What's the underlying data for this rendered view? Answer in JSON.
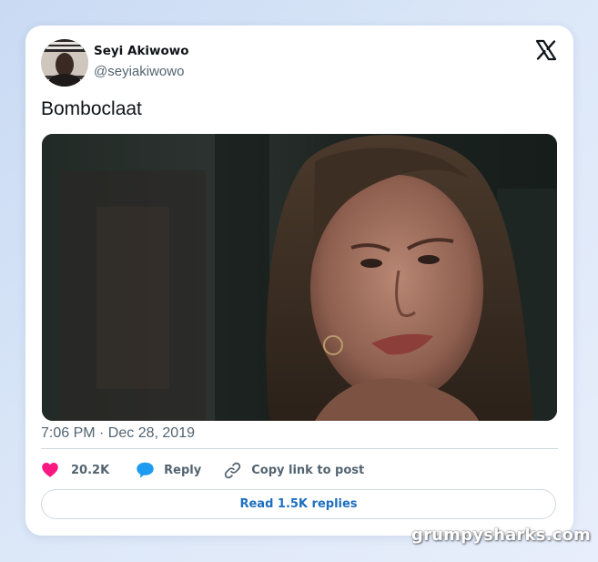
{
  "author": {
    "name": "Seyi Akiwowo",
    "handle": "@seyiakiwowo",
    "avatar_icon": "avatar-photo"
  },
  "platform_icon": "x-logo-icon",
  "tweet": {
    "text": "Bomboclaat",
    "media_icon": "image-thumbnail",
    "timestamp": "7:06 PM · Dec 28, 2019"
  },
  "actions": {
    "like": {
      "icon": "heart-icon",
      "count": "20.2K"
    },
    "reply": {
      "icon": "speech-bubble-icon",
      "label": "Reply"
    },
    "copy": {
      "icon": "link-icon",
      "label": "Copy link to post"
    }
  },
  "read_replies_label": "Read 1.5K replies",
  "watermark": "grumpysharks.com",
  "colors": {
    "heart": "#f91880",
    "reply": "#1d9bf0",
    "link_text": "#1d6fc0",
    "muted_text": "#536471"
  }
}
